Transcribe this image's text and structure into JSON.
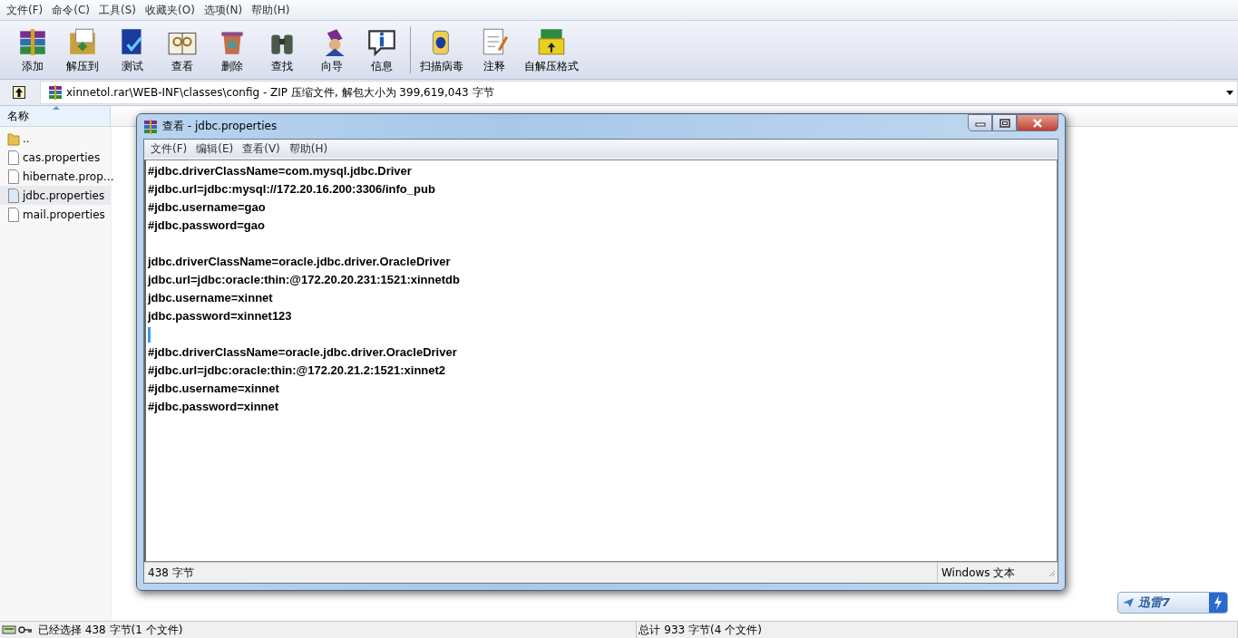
{
  "menu": [
    "文件(F)",
    "命令(C)",
    "工具(S)",
    "收藏夹(O)",
    "选项(N)",
    "帮助(H)"
  ],
  "toolbar": [
    {
      "buttons": [
        {
          "label": "添加",
          "kind": "archive"
        },
        {
          "label": "解压到",
          "kind": "extract"
        },
        {
          "label": "测试",
          "kind": "test"
        },
        {
          "label": "查看",
          "kind": "view"
        },
        {
          "label": "删除",
          "kind": "delete"
        },
        {
          "label": "查找",
          "kind": "find"
        },
        {
          "label": "向导",
          "kind": "wizard"
        },
        {
          "label": "信息",
          "kind": "info"
        }
      ]
    },
    {
      "buttons": [
        {
          "label": "扫描病毒",
          "kind": "scan"
        },
        {
          "label": "注释",
          "kind": "comment"
        },
        {
          "label": "自解压格式",
          "kind": "sfx"
        }
      ]
    }
  ],
  "address": {
    "path": "xinnetol.rar\\WEB-INF\\classes\\config - ZIP 压缩文件, 解包大小为 399,619,043 字节"
  },
  "file_list": {
    "column": "名称",
    "items": [
      {
        "name": "..",
        "kind": "folder",
        "selected": false
      },
      {
        "name": "cas.properties",
        "kind": "file",
        "selected": false
      },
      {
        "name": "hibernate.prop…",
        "kind": "file",
        "selected": false
      },
      {
        "name": "jdbc.properties",
        "kind": "file",
        "selected": true
      },
      {
        "name": "mail.properties",
        "kind": "file",
        "selected": false
      }
    ]
  },
  "viewer": {
    "title": "查看 - jdbc.properties",
    "menu": [
      "文件(F)",
      "编辑(E)",
      "查看(V)",
      "帮助(H)"
    ],
    "blocks": [
      {
        "caret_below": false,
        "lines": [
          "#jdbc.driverClassName=com.mysql.jdbc.Driver",
          "#jdbc.url=jdbc:mysql://172.20.16.200:3306/info_pub",
          "#jdbc.username=gao",
          "#jdbc.password=gao"
        ]
      },
      {
        "caret_below": true,
        "lines": [
          "jdbc.driverClassName=oracle.jdbc.driver.OracleDriver",
          "jdbc.url=jdbc:oracle:thin:@172.20.20.231:1521:xinnetdb",
          "jdbc.username=xinnet",
          "jdbc.password=xinnet123"
        ]
      },
      {
        "caret_below": false,
        "lines": [
          "#jdbc.driverClassName=oracle.jdbc.driver.OracleDriver",
          "#jdbc.url=jdbc:oracle:thin:@172.20.21.2:1521:xinnet2",
          "#jdbc.username=xinnet",
          "#jdbc.password=xinnet"
        ]
      }
    ],
    "status": [
      "438 字节",
      "Windows 文本"
    ]
  },
  "thunder_badge": {
    "label": "迅雷7"
  },
  "status_bar": [
    "已经选择 438 字节(1 个文件)",
    "总计 933 字节(4 个文件)"
  ]
}
